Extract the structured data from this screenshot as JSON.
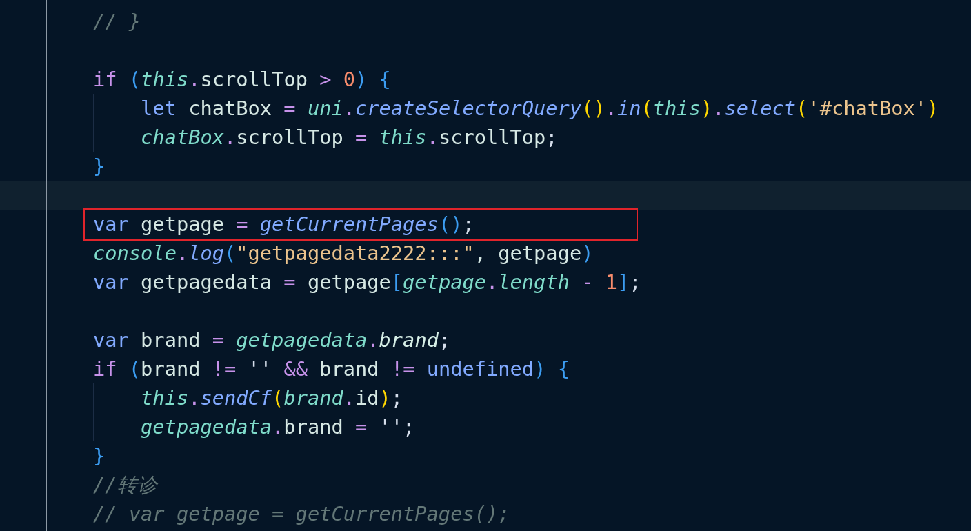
{
  "editor": {
    "lines": [
      {
        "current": false,
        "annotated": false,
        "tokens": [
          {
            "text": "// }",
            "kind": "comment"
          }
        ]
      },
      {
        "current": false,
        "annotated": false
      },
      {
        "current": false,
        "annotated": false,
        "tokens": [
          {
            "text": "if ",
            "kind": "control"
          },
          {
            "text": "(",
            "kind": "bracket"
          },
          {
            "text": "this",
            "kind": "object"
          },
          {
            "text": ".",
            "kind": "op"
          },
          {
            "text": "scrollTop ",
            "kind": "ident"
          },
          {
            "text": "> ",
            "kind": "op"
          },
          {
            "text": "0",
            "kind": "number"
          },
          {
            "text": ")",
            "kind": "bracket"
          },
          {
            "text": " {",
            "kind": "bracket"
          }
        ],
        "children": [
          {
            "current": false,
            "annotated": false,
            "tokens": [
              {
                "text": "let ",
                "kind": "decl"
              },
              {
                "text": "chatBox ",
                "kind": "ident"
              },
              {
                "text": "= ",
                "kind": "op"
              },
              {
                "text": "uni",
                "kind": "object"
              },
              {
                "text": ".",
                "kind": "op"
              },
              {
                "text": "createSelectorQuery",
                "kind": "method"
              },
              {
                "text": "()",
                "kind": "innerbracket"
              },
              {
                "text": ".",
                "kind": "op"
              },
              {
                "text": "in",
                "kind": "method"
              },
              {
                "text": "(",
                "kind": "innerbracket"
              },
              {
                "text": "this",
                "kind": "object"
              },
              {
                "text": ")",
                "kind": "innerbracket"
              },
              {
                "text": ".",
                "kind": "op"
              },
              {
                "text": "select",
                "kind": "method"
              },
              {
                "text": "(",
                "kind": "innerbracket"
              },
              {
                "text": "'#chatBox'",
                "kind": "string"
              },
              {
                "text": ")",
                "kind": "innerbracket"
              }
            ]
          },
          {
            "current": false,
            "annotated": false,
            "tokens": [
              {
                "text": "chatBox",
                "kind": "object"
              },
              {
                "text": ".",
                "kind": "op"
              },
              {
                "text": "scrollTop ",
                "kind": "ident"
              },
              {
                "text": "= ",
                "kind": "op"
              },
              {
                "text": "this",
                "kind": "object"
              },
              {
                "text": ".",
                "kind": "op"
              },
              {
                "text": "scrollTop",
                "kind": "ident"
              },
              {
                "text": ";",
                "kind": "punct"
              }
            ]
          }
        ]
      },
      {
        "current": false,
        "annotated": false,
        "tokens": [
          {
            "text": "}",
            "kind": "bracket"
          }
        ]
      },
      {
        "current": true,
        "annotated": false
      },
      {
        "current": false,
        "annotated": true,
        "tokens": [
          {
            "text": "var ",
            "kind": "decl"
          },
          {
            "text": "getpage ",
            "kind": "ident"
          },
          {
            "text": "= ",
            "kind": "op"
          },
          {
            "text": "getCurrentPages",
            "kind": "method"
          },
          {
            "text": "()",
            "kind": "bracket"
          },
          {
            "text": ";",
            "kind": "punct"
          }
        ]
      },
      {
        "current": false,
        "annotated": false,
        "tokens": [
          {
            "text": "console",
            "kind": "object"
          },
          {
            "text": ".",
            "kind": "op"
          },
          {
            "text": "log",
            "kind": "method"
          },
          {
            "text": "(",
            "kind": "bracket"
          },
          {
            "text": "\"getpagedata2222:::\"",
            "kind": "string"
          },
          {
            "text": ", getpage",
            "kind": "ident"
          },
          {
            "text": ")",
            "kind": "bracket"
          }
        ]
      },
      {
        "current": false,
        "annotated": false,
        "tokens": [
          {
            "text": "var ",
            "kind": "decl"
          },
          {
            "text": "getpagedata ",
            "kind": "ident"
          },
          {
            "text": "= ",
            "kind": "op"
          },
          {
            "text": "getpage",
            "kind": "ident"
          },
          {
            "text": "[",
            "kind": "bracket"
          },
          {
            "text": "getpage",
            "kind": "object"
          },
          {
            "text": ".",
            "kind": "op"
          },
          {
            "text": "length ",
            "kind": "object"
          },
          {
            "text": "- ",
            "kind": "op"
          },
          {
            "text": "1",
            "kind": "number"
          },
          {
            "text": "]",
            "kind": "bracket"
          },
          {
            "text": ";",
            "kind": "punct"
          }
        ]
      },
      {
        "current": false,
        "annotated": false
      },
      {
        "current": false,
        "annotated": false,
        "tokens": [
          {
            "text": "var ",
            "kind": "decl"
          },
          {
            "text": "brand ",
            "kind": "ident"
          },
          {
            "text": "= ",
            "kind": "op"
          },
          {
            "text": "getpagedata",
            "kind": "object"
          },
          {
            "text": ".",
            "kind": "op"
          },
          {
            "text": "brand",
            "kind": "field"
          },
          {
            "text": ";",
            "kind": "punct"
          }
        ]
      },
      {
        "current": false,
        "annotated": false,
        "tokens": [
          {
            "text": "if ",
            "kind": "control"
          },
          {
            "text": "(",
            "kind": "bracket"
          },
          {
            "text": "brand ",
            "kind": "ident"
          },
          {
            "text": "!= ",
            "kind": "op"
          },
          {
            "text": "'' ",
            "kind": "punct"
          },
          {
            "text": "&& ",
            "kind": "op"
          },
          {
            "text": "brand ",
            "kind": "ident"
          },
          {
            "text": "!= ",
            "kind": "op"
          },
          {
            "text": "undefined",
            "kind": "decl"
          },
          {
            "text": ")",
            "kind": "bracket"
          },
          {
            "text": " {",
            "kind": "bracket"
          }
        ],
        "children": [
          {
            "current": false,
            "annotated": false,
            "tokens": [
              {
                "text": "this",
                "kind": "object"
              },
              {
                "text": ".",
                "kind": "op"
              },
              {
                "text": "sendCf",
                "kind": "method"
              },
              {
                "text": "(",
                "kind": "innerbracket"
              },
              {
                "text": "brand",
                "kind": "object"
              },
              {
                "text": ".",
                "kind": "op"
              },
              {
                "text": "id",
                "kind": "ident"
              },
              {
                "text": ")",
                "kind": "innerbracket"
              },
              {
                "text": ";",
                "kind": "punct"
              }
            ]
          },
          {
            "current": false,
            "annotated": false,
            "tokens": [
              {
                "text": "getpagedata",
                "kind": "object"
              },
              {
                "text": ".",
                "kind": "op"
              },
              {
                "text": "brand ",
                "kind": "ident"
              },
              {
                "text": "= ",
                "kind": "op"
              },
              {
                "text": "''",
                "kind": "punct"
              },
              {
                "text": ";",
                "kind": "punct"
              }
            ]
          }
        ]
      },
      {
        "current": false,
        "annotated": false,
        "tokens": [
          {
            "text": "}",
            "kind": "bracket"
          }
        ]
      },
      {
        "current": false,
        "annotated": false,
        "tokens": [
          {
            "text": "//转诊",
            "kind": "comment"
          }
        ]
      },
      {
        "current": false,
        "annotated": false,
        "tokens": [
          {
            "text": "// var getpage = getCurrentPages();",
            "kind": "comment"
          }
        ]
      }
    ]
  }
}
